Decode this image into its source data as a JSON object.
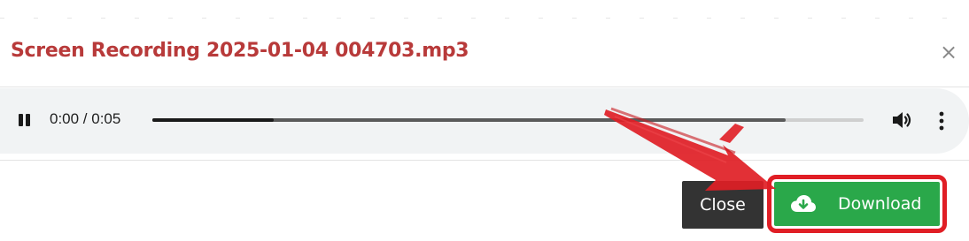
{
  "modal": {
    "title": "Screen Recording 2025-01-04 004703.mp3",
    "close_glyph": "×",
    "close_icon": "close-icon"
  },
  "player": {
    "time": "0:00 / 0:05",
    "progress_fraction": 0.17,
    "buffered_fraction": 0.89,
    "icons": [
      "pause-icon",
      "volume-icon",
      "more-options-icon"
    ]
  },
  "footer": {
    "close_label": "Close",
    "download_label": "Download",
    "download_icon": "cloud-download-icon"
  },
  "colors": {
    "title": "#b83a3a",
    "download": "#2aa84a",
    "close_button": "#333333",
    "highlight": "#e01e25"
  }
}
